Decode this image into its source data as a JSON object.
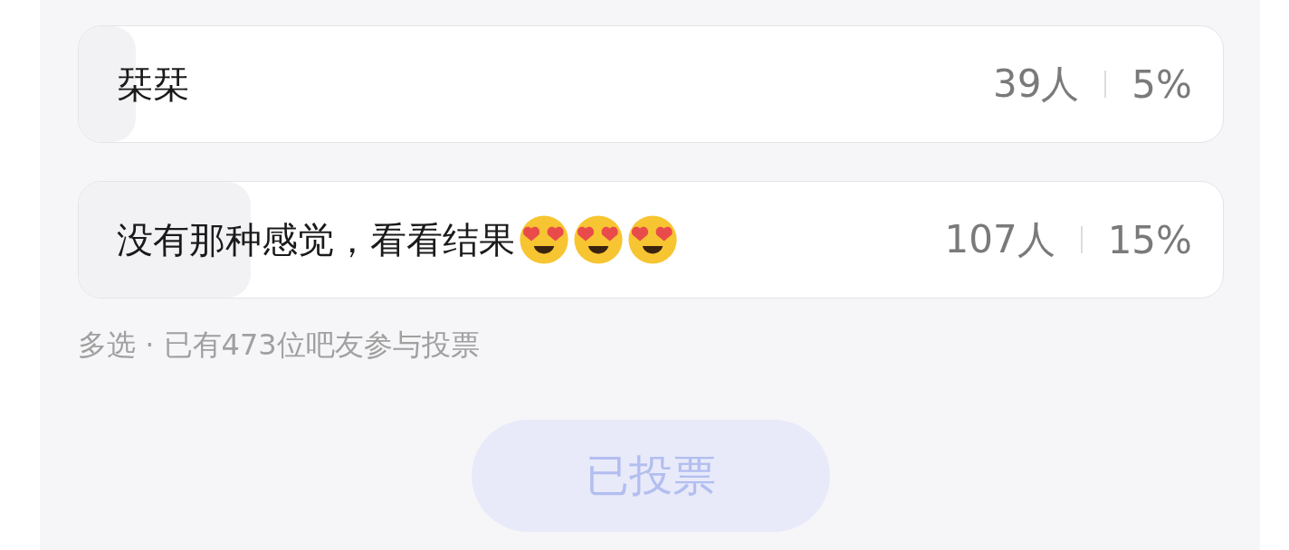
{
  "options": [
    {
      "label": "栞栞",
      "count": "39人",
      "percent": "5%",
      "level": 0.05
    },
    {
      "label": "没有那种感觉，看看结果",
      "emojis": [
        {
          "kind": "heart-eyes"
        },
        {
          "kind": "heart-eyes"
        },
        {
          "kind": "heart-eyes"
        }
      ],
      "count": "107人",
      "percent": "15%",
      "level": 0.15
    }
  ],
  "summary": "多选 · 已有473位吧友参与投票",
  "vote_button": {
    "label": "已投票",
    "disabled": true
  }
}
